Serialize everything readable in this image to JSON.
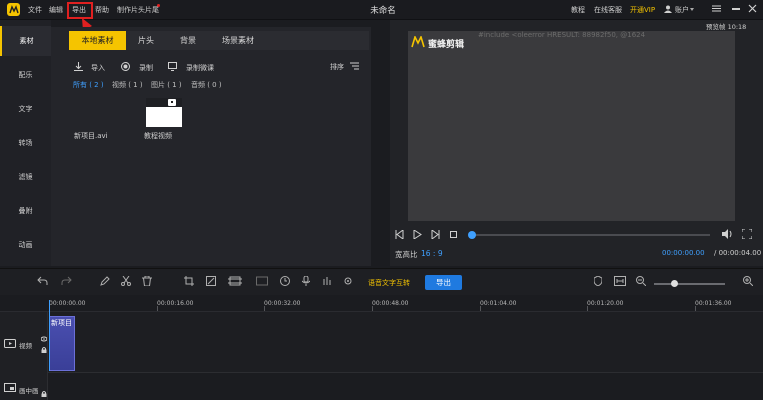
{
  "titlebar": {
    "app_title": "未命名",
    "menu": [
      "文件",
      "编辑",
      "导出",
      "帮助",
      "制作片头片尾"
    ],
    "right": {
      "tutorial": "教程",
      "support": "在线客服",
      "vip": "开通VIP",
      "account": "账户"
    }
  },
  "leftnav": {
    "items": [
      "素材",
      "配乐",
      "文字",
      "转场",
      "滤镜",
      "叠附",
      "动画"
    ]
  },
  "media": {
    "tabs": [
      "本地素材",
      "片头",
      "背景",
      "场景素材"
    ],
    "toolbar": {
      "import": "导入",
      "record": "录制",
      "record_course": "录制微课",
      "sort": "排序"
    },
    "filters": [
      "所有 ( 2 )",
      "视频 ( 1 )",
      "图片 ( 1 )",
      "音频 ( 0 )"
    ],
    "items": [
      {
        "name": "新项目.avi",
        "thumb": "blank"
      },
      {
        "name": "教程视频",
        "thumb": "white"
      }
    ]
  },
  "preview": {
    "top_time": "预览帧 10:18",
    "logo_text": "蜜蜂剪辑",
    "error_text": "#include <oleerror HRESULT: 88982f50, @1624",
    "aspect_label": "宽高比",
    "aspect_value": "16 : 9",
    "time_current": "00:00:00.00",
    "time_total": "/ 00:00:04.00",
    "progress": 0.0
  },
  "timeline": {
    "voice_to_text": "语音文字互转",
    "export_label": "导出",
    "ruler": [
      "00:00:00.00",
      "00:00:16.00",
      "00:00:32.00",
      "00:00:48.00",
      "00:01:04.00",
      "00:01:20.00",
      "00:01:36.00"
    ],
    "tracks": [
      {
        "label": "视频",
        "clip_label": "新项目"
      },
      {
        "label": "画中画"
      }
    ]
  },
  "colors": {
    "accent": "#f5c400",
    "blue": "#3fa0ff",
    "highlight": "#e02020",
    "button": "#1f7ae0"
  }
}
